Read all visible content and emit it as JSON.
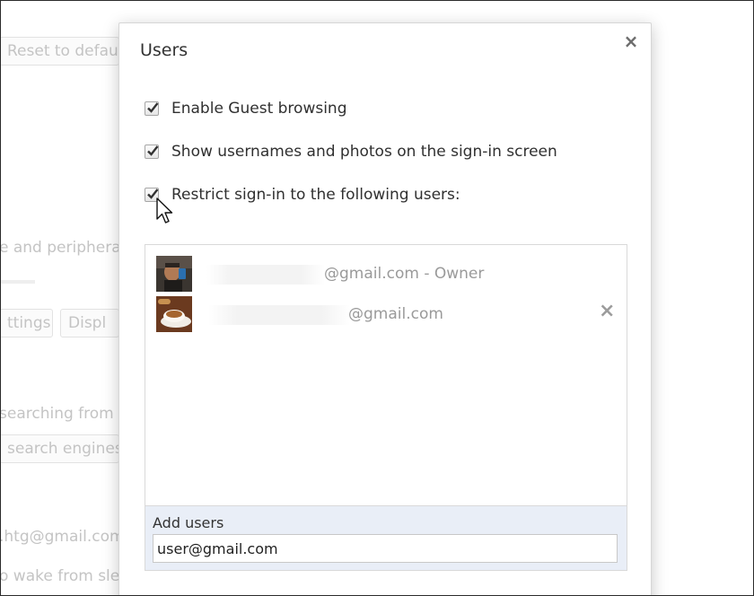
{
  "background": {
    "reset_button": "Reset to default",
    "device_text": "e and peripherals",
    "settings_button": "ttings",
    "display_button": "Displ",
    "searching_text": " searching from",
    "engines_button": "search engines...",
    "account_text": ".htg@gmail.com",
    "wake_text": "o wake from slee"
  },
  "dialog": {
    "title": "Users",
    "close_glyph": "×",
    "options": [
      {
        "label": "Enable Guest browsing",
        "checked": true
      },
      {
        "label": "Show usernames and photos on the sign-in screen",
        "checked": true
      },
      {
        "label": "Restrict sign-in to the following users:",
        "checked": true
      }
    ],
    "users": [
      {
        "email": "@gmail.com - Owner",
        "avatar": "person-photo"
      },
      {
        "email": "@gmail.com",
        "avatar": "coffee-cup-photo",
        "remove_glyph": "×"
      }
    ],
    "add_users": {
      "label": "Add users",
      "value": "user@gmail.com"
    }
  }
}
